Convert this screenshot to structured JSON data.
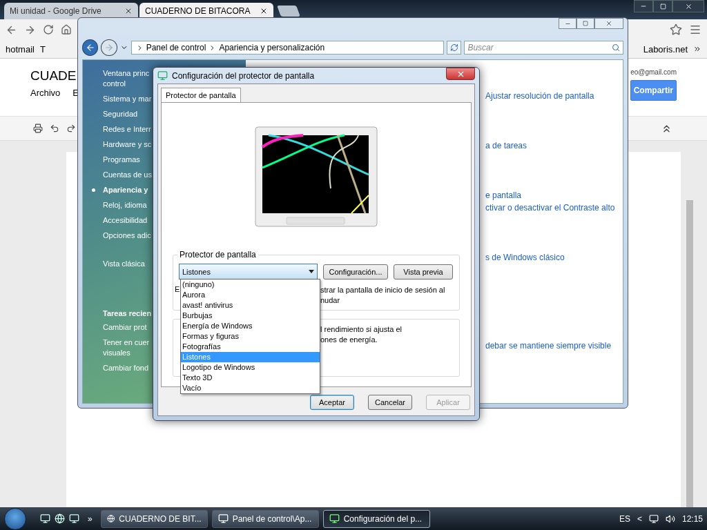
{
  "browser": {
    "tabs": [
      {
        "label": "Mi unidad - Google Drive",
        "selected": false
      },
      {
        "label": "CUADERNO DE BITACORA",
        "selected": true
      }
    ],
    "bookmarks": [
      "hotmail",
      "T",
      "Laboris.net"
    ],
    "document": {
      "title": "CUADE",
      "menu": [
        "Archivo",
        "E"
      ],
      "account": "eo@gmail.com",
      "share_button": "Compartir"
    }
  },
  "control_panel": {
    "breadcrumb": [
      "Panel de control",
      "Apariencia y personalización"
    ],
    "search": {
      "placeholder": "Buscar"
    },
    "sidebar": {
      "items": [
        {
          "label": "Ventana princ\ncontrol",
          "selected": false
        },
        {
          "label": "Sistema y mar",
          "selected": false
        },
        {
          "label": "Seguridad",
          "selected": false
        },
        {
          "label": "Redes e Interr",
          "selected": false
        },
        {
          "label": "Hardware y sc",
          "selected": false
        },
        {
          "label": "Programas",
          "selected": false
        },
        {
          "label": "Cuentas de us",
          "selected": false
        },
        {
          "label": "Apariencia y",
          "selected": true
        },
        {
          "label": "Reloj, idioma",
          "selected": false
        },
        {
          "label": "Accesibilidad",
          "selected": false
        },
        {
          "label": "Opciones adic",
          "selected": false
        }
      ],
      "classic_view": "Vista clásica",
      "recent_heading": "Tareas recien",
      "recent_tasks": [
        "Cambiar prot",
        "Tener en cuer\nvisuales",
        "Cambiar fond"
      ]
    },
    "link_groups": [
      [
        "Ajustar resolución de pantalla"
      ],
      [
        "a de tareas"
      ],
      [
        "e pantalla",
        "ctivar o desactivar el Contraste alto"
      ],
      [
        "s de Windows clásico"
      ],
      [
        "debar se mantiene siempre visible"
      ]
    ]
  },
  "dialog": {
    "title": "Configuración del protector de pantalla",
    "tabs": [
      {
        "label": "Protector de pantalla",
        "selected": true
      }
    ],
    "group_label": "Protector de pantalla",
    "combo_value": "Listones",
    "side_buttons": [
      "Configuración...",
      "Vista previa"
    ],
    "note_start": "E",
    "note_rest": "strar la pantalla de inicio de sesión al\nnudar",
    "power_rest": "l rendimiento si ajusta el\nones de energía.",
    "options": [
      {
        "label": "(ninguno)",
        "selected": false
      },
      {
        "label": "Aurora",
        "selected": false
      },
      {
        "label": "avast! antivirus",
        "selected": false
      },
      {
        "label": "Burbujas",
        "selected": false
      },
      {
        "label": "Energía de Windows",
        "selected": false
      },
      {
        "label": "Formas y figuras",
        "selected": false
      },
      {
        "label": "Fotografías",
        "selected": false
      },
      {
        "label": "Listones",
        "selected": true
      },
      {
        "label": "Logotipo de Windows",
        "selected": false
      },
      {
        "label": "Texto 3D",
        "selected": false
      },
      {
        "label": "Vacío",
        "selected": false
      }
    ],
    "buttons": [
      {
        "label": "Aceptar",
        "default": true,
        "disabled": false
      },
      {
        "label": "Cancelar",
        "default": false,
        "disabled": false
      },
      {
        "label": "Aplicar",
        "default": false,
        "disabled": true
      }
    ]
  },
  "taskbar": {
    "more": "»",
    "tasks": [
      {
        "label": "CUADERNO DE BIT...",
        "kind": "chrome",
        "selected": false
      },
      {
        "label": "Panel de control\\Ap...",
        "kind": "panel",
        "selected": false
      },
      {
        "label": "Configuración del p...",
        "kind": "screensaver",
        "selected": true
      }
    ],
    "language": "ES",
    "tray_toggle": "<",
    "time": "12:15"
  }
}
